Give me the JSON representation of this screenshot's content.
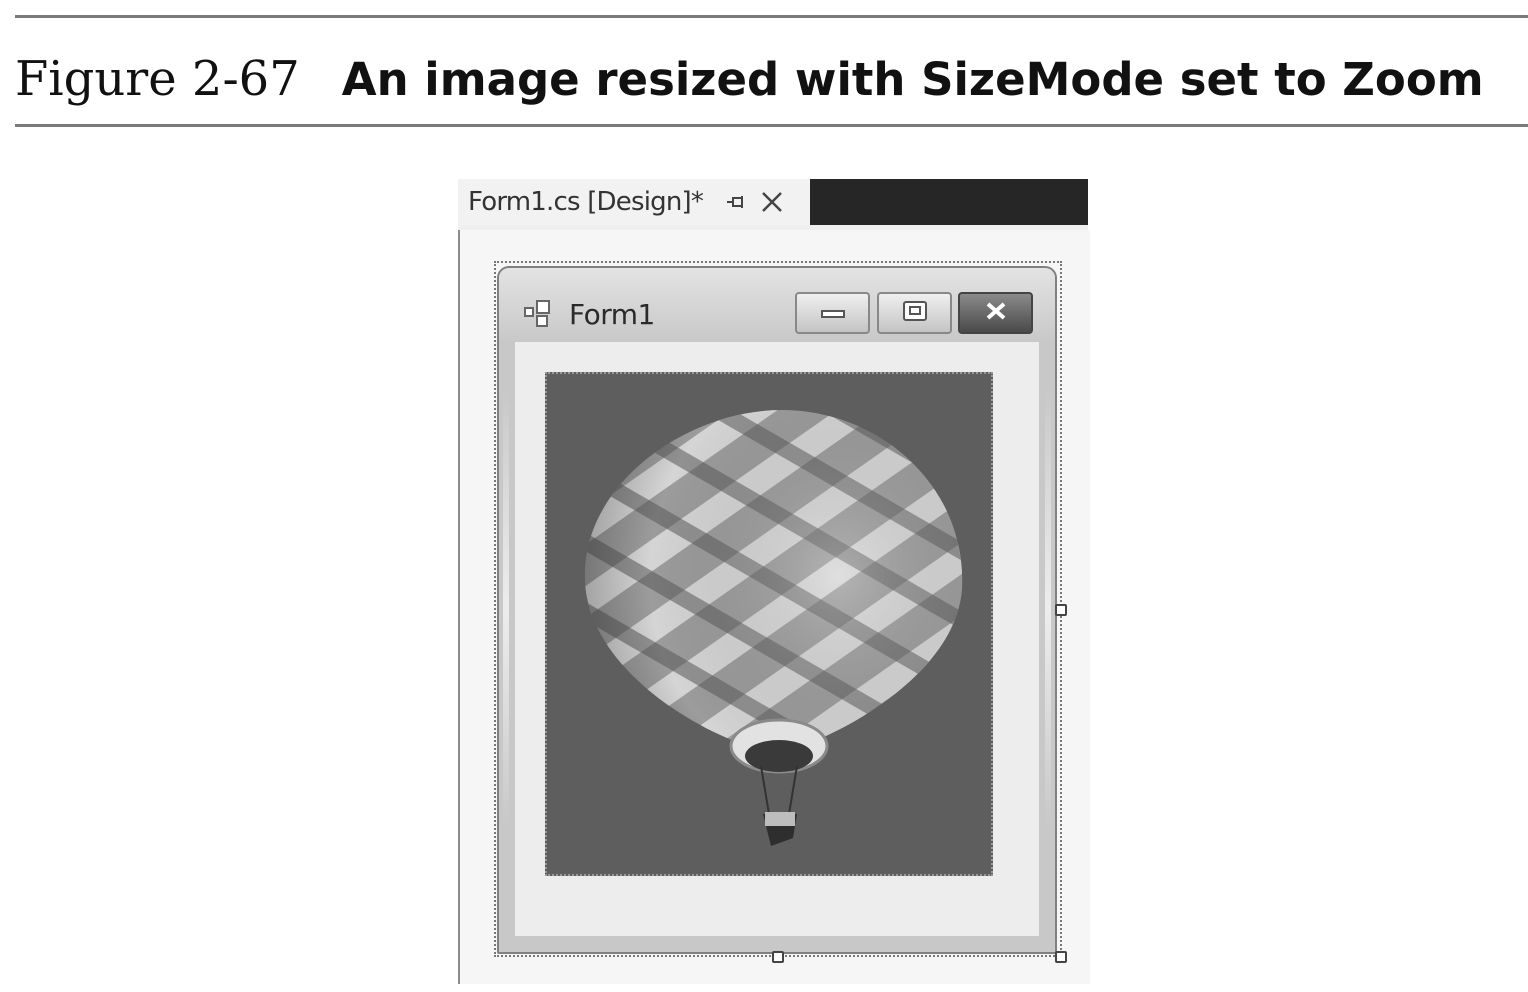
{
  "caption": {
    "figure_number": "Figure 2-67",
    "title": "An image resized with SizeMode set to Zoom"
  },
  "designer": {
    "tab_label": "Form1.cs [Design]*",
    "pin_icon": "pin-icon",
    "close_icon": "close-icon"
  },
  "form": {
    "title": "Form1",
    "app_icon": "form-app-icon",
    "buttons": [
      "minimize-icon",
      "maximize-icon",
      "close-icon"
    ]
  },
  "picturebox": {
    "image": "hot-air-balloon",
    "size_mode": "Zoom"
  },
  "colors": {
    "dark_bar": "#262626",
    "picture_background": "#5e5e5e",
    "client_background": "#ededed"
  }
}
